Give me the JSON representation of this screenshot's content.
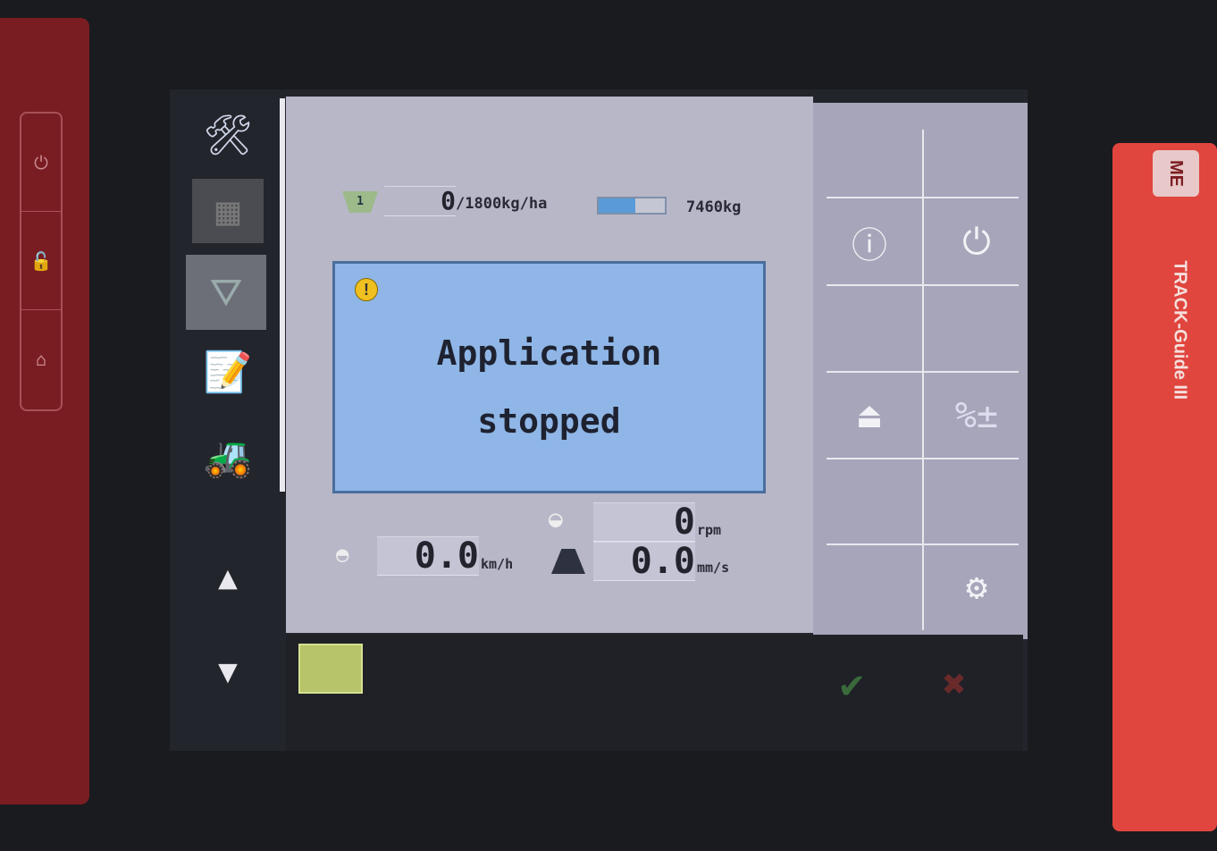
{
  "device": {
    "brand": "ME",
    "model": "TRACK-Guide III"
  },
  "status": {
    "section_badge": "1",
    "rate_value": "0",
    "rate_target": "/1800kg/ha",
    "hopper_fill_percent": 55,
    "hopper_weight": "7460kg"
  },
  "alarm": {
    "line1": "Application",
    "line2": "stopped"
  },
  "readouts": {
    "speed_value": "0.0",
    "speed_unit": "km/h",
    "disc_rpm_value": "0",
    "disc_rpm_unit": "rpm",
    "slide_value": "0.0",
    "slide_unit": "mm/s"
  },
  "colors": {
    "alarm_bg": "#8fb6e6",
    "panel_bg": "#b8b7c8",
    "accent_red": "#e0453e"
  }
}
